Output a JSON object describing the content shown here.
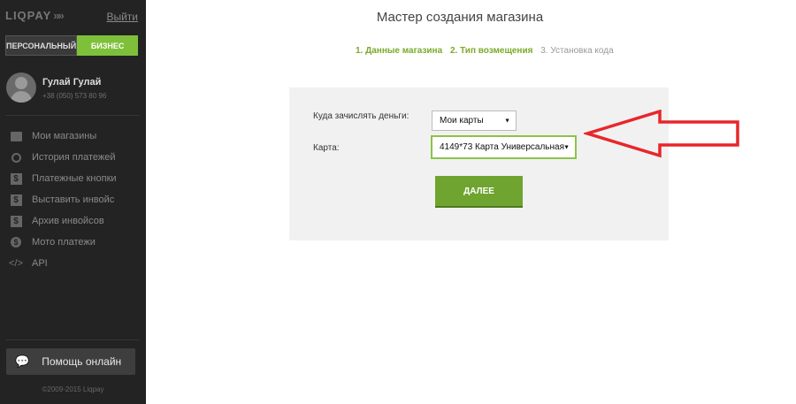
{
  "sidebar": {
    "logo": "LIQPAY",
    "logout_label": "Выйти",
    "tabs": [
      "ПЕРСОНАЛЬНЫЙ",
      "БИЗНЕС"
    ],
    "user": {
      "name": "Гулай Гулай",
      "phone": "+38 (050) 573 80 96"
    },
    "nav": [
      {
        "label": "Мои магазины",
        "icon": "shop-icon"
      },
      {
        "label": "История платежей",
        "icon": "history-icon"
      },
      {
        "label": "Платежные кнопки",
        "icon": "dollar-icon"
      },
      {
        "label": "Выставить инвойс",
        "icon": "dollar-icon"
      },
      {
        "label": "Архив инвойсов",
        "icon": "dollar-icon"
      },
      {
        "label": "Мото платежи",
        "icon": "coin-icon"
      },
      {
        "label": "API",
        "icon": "code-icon"
      }
    ],
    "help_label": "Помощь онлайн",
    "copyright": "©2009-2015 Liqpay"
  },
  "main": {
    "title": "Мастер создания магазина",
    "steps": [
      "1. Данные магазина",
      "2. Тип возмещения",
      "3. Установка кода"
    ],
    "form": {
      "destination_label": "Куда зачислять деньги:",
      "destination_value": "Мои карты",
      "card_label": "Карта:",
      "card_value": "4149*73 Карта Универсальная",
      "next_label": "ДАЛЕЕ"
    }
  },
  "colors": {
    "accent": "#7fc03a",
    "sidebar_bg": "#232323",
    "annotation_arrow": "#e8262a"
  }
}
